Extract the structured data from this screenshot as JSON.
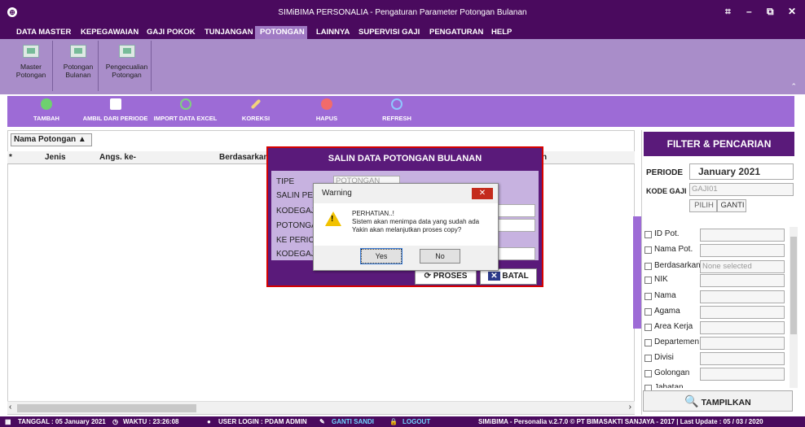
{
  "window": {
    "title": "SIMiBIMA PERSONALIA - Pengaturan Parameter Potongan Bulanan",
    "logo": "logo-icon",
    "controls": [
      "⌗",
      "–",
      "⧉",
      "✕"
    ]
  },
  "menu": [
    "DATA MASTER",
    "KEPEGAWAIAN",
    "GAJI POKOK",
    "TUNJANGAN",
    "POTONGAN",
    "LAINNYA",
    "SUPERVISI GAJI",
    "PENGATURAN",
    "HELP"
  ],
  "menu_active": "POTONGAN",
  "ribbon": [
    {
      "line1": "Master",
      "line2": "Potongan"
    },
    {
      "line1": "Potongan",
      "line2": "Bulanan"
    },
    {
      "line1": "Pengecualian",
      "line2": "Potongan"
    }
  ],
  "toolbar": [
    "TAMBAH",
    "AMBIL DARI PERIODE",
    "IMPORT DATA EXCEL",
    "KOREKSI",
    "HAPUS",
    "REFRESH"
  ],
  "grid": {
    "group_by": "Nama Potongan ▲",
    "columns": [
      "*",
      "Jenis",
      "Angs. ke-",
      "Berdasarkan"
    ],
    "col_extra": "n"
  },
  "filter": {
    "header": "FILTER & PENCARIAN",
    "periode_label": "PERIODE",
    "periode_value": "January  2021",
    "kodegaji_label": "KODE GAJI",
    "kodegaji_value": "GAJI01",
    "pilih": "PILIH",
    "ganti": "GANTI",
    "fields": [
      "ID Pot.",
      "Nama Pot.",
      "Berdasarkan",
      "NIK",
      "Nama",
      "Agama",
      "Area Kerja",
      "Departemen",
      "Divisi",
      "Golongan",
      "Jabatan"
    ],
    "berdasarkan_placeholder": "None selected",
    "tampilkan": "TAMPILKAN"
  },
  "dialog": {
    "title": "SALIN DATA POTONGAN BULANAN",
    "labels": [
      "TIPE",
      "SALIN PER",
      "KODEGAJI",
      "POTONGA",
      "KE PERIO",
      "KODEGAJ"
    ],
    "tipe_value": "POTONGAN",
    "proses": "PROSES",
    "batal": "BATAL"
  },
  "warning": {
    "title": "Warning",
    "line1": "PERHATIAN..!",
    "line2": "Sistem akan menimpa data yang sudah ada",
    "line3": "Yakin akan melanjutkan proses copy?",
    "yes": "Yes",
    "no": "No"
  },
  "status": {
    "tanggal": "TANGGAL : 05 January 2021",
    "waktu": "WAKTU : 23:26:08",
    "user": "USER LOGIN : PDAM ADMIN",
    "ganti_sandi": "GANTI SANDI",
    "logout": "LOGOUT",
    "version": "SIMiBIMA - Personalia v.2.7.0 © PT BIMASAKTI SANJAYA - 2017  |  Last Update : 05 / 03 / 2020"
  },
  "colors": {
    "primary": "#4a0a5e",
    "ribbon": "#a98dc9",
    "toolbar": "#9d6bd6",
    "dialog_border": "#d60000"
  }
}
